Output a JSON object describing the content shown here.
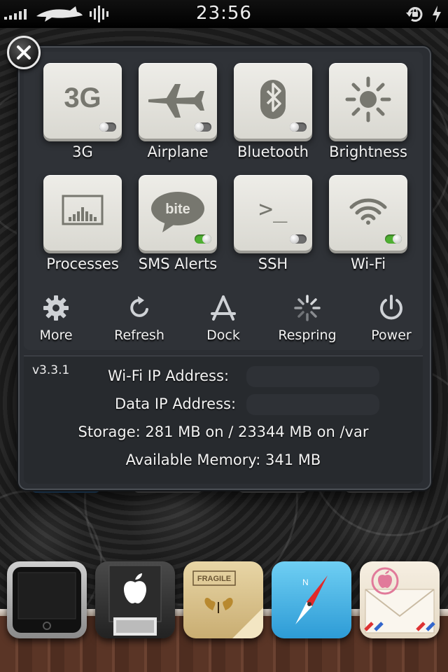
{
  "status_bar": {
    "time": "23:56",
    "icons": [
      "signal-icon",
      "shark-carrier-logo",
      "waveform-icon",
      "rotation-lock-icon",
      "battery-icon"
    ]
  },
  "close_icon": "close-icon",
  "toggles": [
    {
      "label": "3G",
      "icon": "3g-icon",
      "glyph_text": "3G",
      "state": "off"
    },
    {
      "label": "Airplane",
      "icon": "airplane-icon",
      "state": "off"
    },
    {
      "label": "Bluetooth",
      "icon": "bluetooth-icon",
      "state": "off"
    },
    {
      "label": "Brightness",
      "icon": "brightness-icon",
      "state": "none"
    },
    {
      "label": "Processes",
      "icon": "processes-icon",
      "state": "none"
    },
    {
      "label": "SMS Alerts",
      "icon": "sms-bubble-icon",
      "glyph_text": "bite",
      "state": "on"
    },
    {
      "label": "SSH",
      "icon": "terminal-icon",
      "glyph_text": ">_",
      "state": "off"
    },
    {
      "label": "Wi-Fi",
      "icon": "wifi-icon",
      "state": "on"
    }
  ],
  "actions": [
    {
      "label": "More",
      "icon": "gear-icon"
    },
    {
      "label": "Refresh",
      "icon": "refresh-icon"
    },
    {
      "label": "Dock",
      "icon": "app-store-icon"
    },
    {
      "label": "Respring",
      "icon": "spinner-icon"
    },
    {
      "label": "Power",
      "icon": "power-icon"
    }
  ],
  "info": {
    "version": "v3.3.1",
    "wifi_ip_label": "Wi-Fi IP Address:",
    "data_ip_label": "Data IP Address:",
    "storage": "Storage: 281 MB on / 23344 MB on /var",
    "memory": "Available Memory: 341 MB"
  },
  "dock": [
    {
      "icon": "phone-icon"
    },
    {
      "icon": "app-store-apple-icon"
    },
    {
      "icon": "fragile-box-icon",
      "text": "FRAGILE"
    },
    {
      "icon": "safari-compass-icon"
    },
    {
      "icon": "mail-envelope-icon"
    }
  ],
  "colors": {
    "switch_on": "#4fb032",
    "switch_off": "#6e6e6e",
    "panel": "#2b2e33",
    "tile": "#e6e5df"
  }
}
